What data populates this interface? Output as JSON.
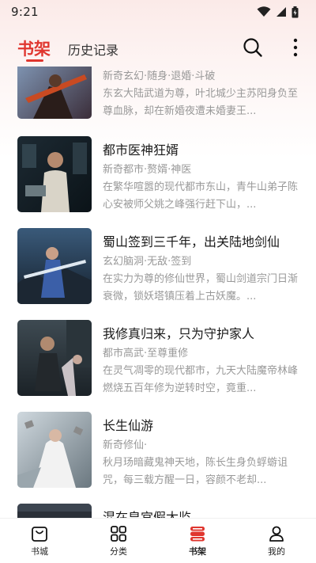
{
  "status_bar": {
    "time": "9:21"
  },
  "top_nav": {
    "tabs": [
      {
        "label": "书架",
        "active": true
      },
      {
        "label": "历史记录",
        "active": false
      }
    ]
  },
  "books": [
    {
      "title": "",
      "tags": "新奇玄幻·随身·退婚·斗破",
      "description": "东玄大陆武道为尊，叶北城少主苏阳身负至尊血脉，却在新婚夜遭未婚妻王..."
    },
    {
      "title": "都市医神狂婿",
      "tags": "新奇都市·赘婿·神医",
      "description": "在繁华喧嚣的现代都市东山，青牛山弟子陈心安被师父姚之峰强行赶下山，..."
    },
    {
      "title": "蜀山签到三千年，出关陆地剑仙",
      "tags": "玄幻脑洞·无敌·签到",
      "description": "在实力为尊的修仙世界，蜀山剑道宗门日渐衰微，锁妖塔镇压着上古妖魔。..."
    },
    {
      "title": "我修真归来，只为守护家人",
      "tags": "都市高武·至尊重修",
      "description": "在灵气凋零的现代都市，九天大陆魔帝林峰燃烧五百年修为逆转时空，竟重..."
    },
    {
      "title": "长生仙游",
      "tags": "新奇修仙·",
      "description": "秋月玚暗藏鬼神天地，陈长生身负蜉蝣诅咒，每三载方醒一日，容颜不老却..."
    },
    {
      "title": "混在皇宫假太监",
      "tags": "",
      "description": ""
    }
  ],
  "bottom_nav": {
    "items": [
      {
        "label": "书城",
        "icon": "bag-icon"
      },
      {
        "label": "分类",
        "icon": "grid-icon"
      },
      {
        "label": "书架",
        "icon": "bookshelf-icon",
        "active": true
      },
      {
        "label": "我的",
        "icon": "person-icon"
      }
    ]
  },
  "colors": {
    "accent": "#e0362f",
    "text_primary": "#1a1a1a",
    "text_secondary": "#999999"
  }
}
